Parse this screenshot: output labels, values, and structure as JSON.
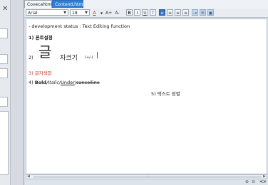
{
  "left_panel": {
    "close_glyph": "✕"
  },
  "tabs": [
    {
      "label": "Covecahtml",
      "active": false
    },
    {
      "label": "ContentLhtml",
      "active": true
    }
  ],
  "toolbar": {
    "font_family": "Arial",
    "font_size": "18",
    "text_color_glyph": "A",
    "grow_font": "A+",
    "shrink_font": "A-",
    "bold": "B",
    "italic": "I",
    "underline": "U",
    "strike": "T"
  },
  "document": {
    "status_line": "- development status : Text Editing function",
    "item1": "1) 폰트설정",
    "item2_prefix": "2)",
    "item2_glyph": "글",
    "item2_text": "자크기",
    "item2_small": "(+/-)",
    "item3": "3) 글자색깔",
    "item4_prefix": "4)",
    "item4_bold": "Bold",
    "item4_italic": "/Italic/",
    "item4_underline": "Under",
    "item4_sep": "/",
    "item4_strike": "cancelline",
    "item5": "5) 텍스트 정렬"
  },
  "status_bar": {
    "zoom_in": "⊕",
    "zoom_out": "⊖",
    "code_view": "<>"
  }
}
